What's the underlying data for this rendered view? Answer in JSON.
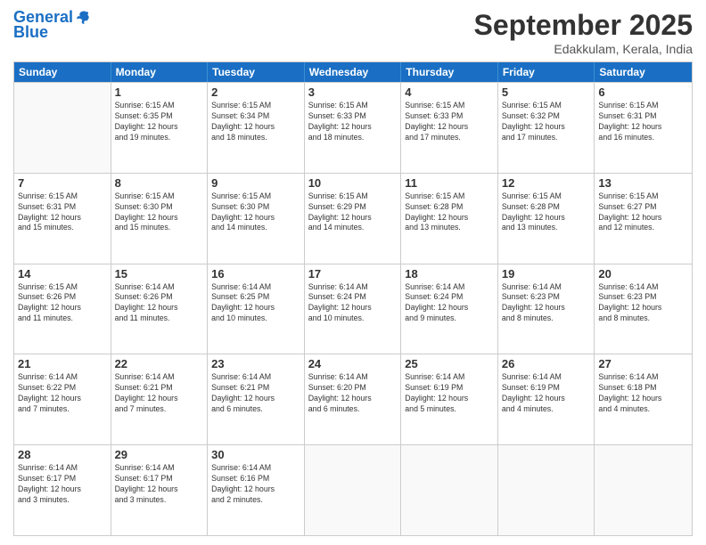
{
  "header": {
    "logo_line1": "General",
    "logo_line2": "Blue",
    "month": "September 2025",
    "location": "Edakkulam, Kerala, India"
  },
  "days_of_week": [
    "Sunday",
    "Monday",
    "Tuesday",
    "Wednesday",
    "Thursday",
    "Friday",
    "Saturday"
  ],
  "weeks": [
    [
      {
        "day": "",
        "empty": true
      },
      {
        "day": "1",
        "sunrise": "6:15 AM",
        "sunset": "6:35 PM",
        "daylight": "12 hours and 19 minutes."
      },
      {
        "day": "2",
        "sunrise": "6:15 AM",
        "sunset": "6:34 PM",
        "daylight": "12 hours and 18 minutes."
      },
      {
        "day": "3",
        "sunrise": "6:15 AM",
        "sunset": "6:33 PM",
        "daylight": "12 hours and 18 minutes."
      },
      {
        "day": "4",
        "sunrise": "6:15 AM",
        "sunset": "6:33 PM",
        "daylight": "12 hours and 17 minutes."
      },
      {
        "day": "5",
        "sunrise": "6:15 AM",
        "sunset": "6:32 PM",
        "daylight": "12 hours and 17 minutes."
      },
      {
        "day": "6",
        "sunrise": "6:15 AM",
        "sunset": "6:31 PM",
        "daylight": "12 hours and 16 minutes."
      }
    ],
    [
      {
        "day": "7",
        "sunrise": "6:15 AM",
        "sunset": "6:31 PM",
        "daylight": "12 hours and 15 minutes."
      },
      {
        "day": "8",
        "sunrise": "6:15 AM",
        "sunset": "6:30 PM",
        "daylight": "12 hours and 15 minutes."
      },
      {
        "day": "9",
        "sunrise": "6:15 AM",
        "sunset": "6:30 PM",
        "daylight": "12 hours and 14 minutes."
      },
      {
        "day": "10",
        "sunrise": "6:15 AM",
        "sunset": "6:29 PM",
        "daylight": "12 hours and 14 minutes."
      },
      {
        "day": "11",
        "sunrise": "6:15 AM",
        "sunset": "6:28 PM",
        "daylight": "12 hours and 13 minutes."
      },
      {
        "day": "12",
        "sunrise": "6:15 AM",
        "sunset": "6:28 PM",
        "daylight": "12 hours and 13 minutes."
      },
      {
        "day": "13",
        "sunrise": "6:15 AM",
        "sunset": "6:27 PM",
        "daylight": "12 hours and 12 minutes."
      }
    ],
    [
      {
        "day": "14",
        "sunrise": "6:15 AM",
        "sunset": "6:26 PM",
        "daylight": "12 hours and 11 minutes."
      },
      {
        "day": "15",
        "sunrise": "6:14 AM",
        "sunset": "6:26 PM",
        "daylight": "12 hours and 11 minutes."
      },
      {
        "day": "16",
        "sunrise": "6:14 AM",
        "sunset": "6:25 PM",
        "daylight": "12 hours and 10 minutes."
      },
      {
        "day": "17",
        "sunrise": "6:14 AM",
        "sunset": "6:24 PM",
        "daylight": "12 hours and 10 minutes."
      },
      {
        "day": "18",
        "sunrise": "6:14 AM",
        "sunset": "6:24 PM",
        "daylight": "12 hours and 9 minutes."
      },
      {
        "day": "19",
        "sunrise": "6:14 AM",
        "sunset": "6:23 PM",
        "daylight": "12 hours and 8 minutes."
      },
      {
        "day": "20",
        "sunrise": "6:14 AM",
        "sunset": "6:23 PM",
        "daylight": "12 hours and 8 minutes."
      }
    ],
    [
      {
        "day": "21",
        "sunrise": "6:14 AM",
        "sunset": "6:22 PM",
        "daylight": "12 hours and 7 minutes."
      },
      {
        "day": "22",
        "sunrise": "6:14 AM",
        "sunset": "6:21 PM",
        "daylight": "12 hours and 7 minutes."
      },
      {
        "day": "23",
        "sunrise": "6:14 AM",
        "sunset": "6:21 PM",
        "daylight": "12 hours and 6 minutes."
      },
      {
        "day": "24",
        "sunrise": "6:14 AM",
        "sunset": "6:20 PM",
        "daylight": "12 hours and 6 minutes."
      },
      {
        "day": "25",
        "sunrise": "6:14 AM",
        "sunset": "6:19 PM",
        "daylight": "12 hours and 5 minutes."
      },
      {
        "day": "26",
        "sunrise": "6:14 AM",
        "sunset": "6:19 PM",
        "daylight": "12 hours and 4 minutes."
      },
      {
        "day": "27",
        "sunrise": "6:14 AM",
        "sunset": "6:18 PM",
        "daylight": "12 hours and 4 minutes."
      }
    ],
    [
      {
        "day": "28",
        "sunrise": "6:14 AM",
        "sunset": "6:17 PM",
        "daylight": "12 hours and 3 minutes."
      },
      {
        "day": "29",
        "sunrise": "6:14 AM",
        "sunset": "6:17 PM",
        "daylight": "12 hours and 3 minutes."
      },
      {
        "day": "30",
        "sunrise": "6:14 AM",
        "sunset": "6:16 PM",
        "daylight": "12 hours and 2 minutes."
      },
      {
        "day": "",
        "empty": true
      },
      {
        "day": "",
        "empty": true
      },
      {
        "day": "",
        "empty": true
      },
      {
        "day": "",
        "empty": true
      }
    ]
  ]
}
